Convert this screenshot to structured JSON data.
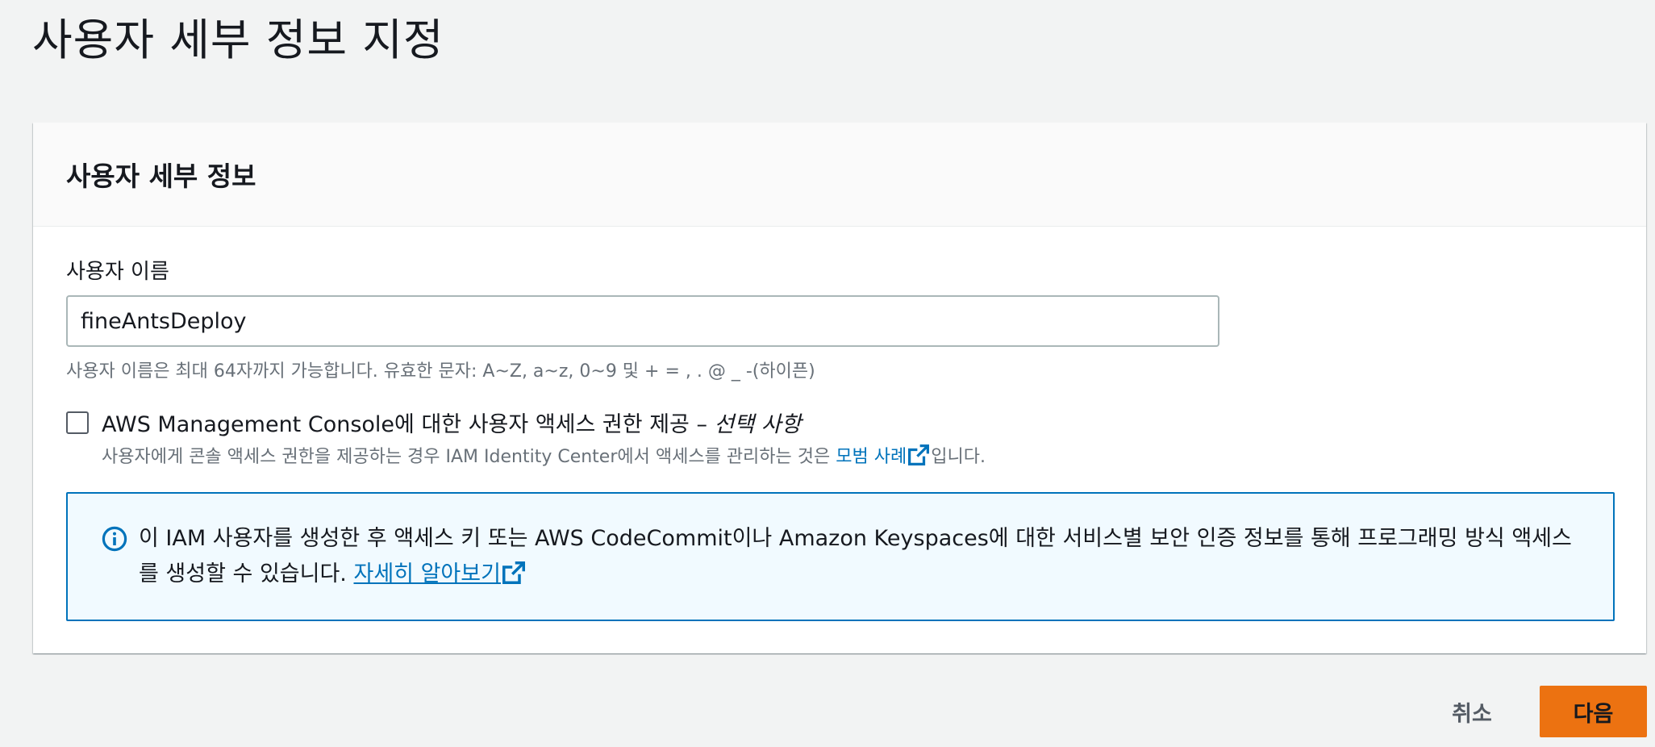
{
  "page": {
    "title": "사용자 세부 정보 지정"
  },
  "panel": {
    "title": "사용자 세부 정보",
    "username": {
      "label": "사용자 이름",
      "value": "fineAntsDeploy",
      "hint": "사용자 이름은 최대 64자까지 가능합니다. 유효한 문자: A~Z, a~z, 0~9 및 + = , . @ _ -(하이픈)"
    },
    "console_access": {
      "label": "AWS Management Console에 대한 사용자 액세스 권한 제공 – ",
      "optional": "선택 사항",
      "checked": false,
      "desc_before": "사용자에게 콘솔 액세스 권한을 제공하는 경우 IAM Identity Center에서 액세스를 관리하는 것은 ",
      "desc_link": "모범 사례",
      "desc_after": "입니다."
    },
    "info": {
      "icon": "info-icon",
      "text": "이 IAM 사용자를 생성한 후 액세스 키 또는 AWS CodeCommit이나 Amazon Keyspaces에 대한 서비스별 보안 인증 정보를 통해 프로그래밍 방식 액세스를 생성할 수 있습니다. ",
      "link": "자세히 알아보기"
    }
  },
  "actions": {
    "cancel": "취소",
    "next": "다음"
  },
  "colors": {
    "link": "#0073bb",
    "primary": "#ec7211",
    "info_bg": "#f1faff"
  }
}
